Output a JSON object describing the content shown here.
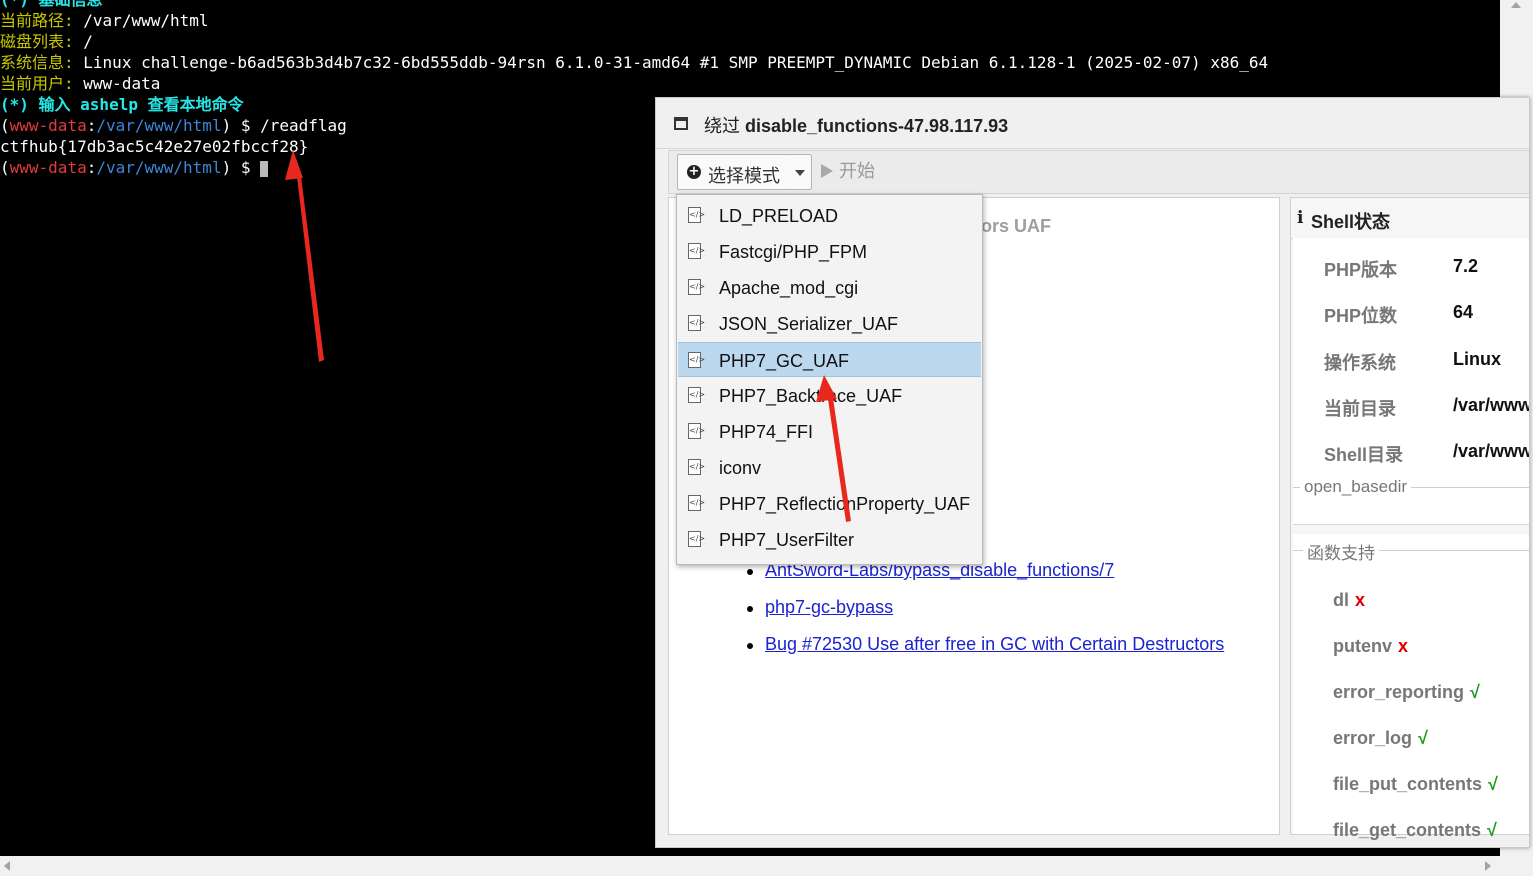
{
  "terminal": {
    "line0": "(*) 基础信息",
    "line1_label": "当前路径: ",
    "line1_value": "/var/www/html",
    "line2_label": "磁盘列表: ",
    "line2_value": "/",
    "line3_label": "系统信息: ",
    "line3_value": "Linux challenge-b6ad563b3d4b7c32-6bd555ddb-94rsn 6.1.0-31-amd64 #1 SMP PREEMPT_DYNAMIC Debian 6.1.128-1 (2025-02-07) x86_64",
    "line4_label": "当前用户: ",
    "line4_value": "www-data",
    "line5": "(*) 输入 ashelp 查看本地命令",
    "prompt_open": "(",
    "prompt_user": "www-data",
    "prompt_colon": ":",
    "prompt_path": "/var/www/html",
    "prompt_close": ") $ ",
    "command": "/readflag",
    "output": "ctfhub{17db3ac5c42e27e02fbccf28}"
  },
  "dialog": {
    "title_prefix": "绕过 ",
    "title_bold": "disable_functions-47.98.117.93",
    "mode_button": "选择模式",
    "start_button": "开始",
    "heading_partial": "ors UAF",
    "links": [
      "AntSword-Labs/bypass_disable_functions/7",
      "php7-gc-bypass",
      "Bug #72530 Use after free in GC with Certain Destructors"
    ]
  },
  "modes": [
    "LD_PRELOAD",
    "Fastcgi/PHP_FPM",
    "Apache_mod_cgi",
    "JSON_Serializer_UAF",
    "PHP7_GC_UAF",
    "PHP7_Backtrace_UAF",
    "PHP74_FFI",
    "iconv",
    "PHP7_ReflectionProperty_UAF",
    "PHP7_UserFilter"
  ],
  "shell_status": {
    "title": "Shell状态",
    "rows": [
      {
        "label": "PHP版本",
        "value": "7.2"
      },
      {
        "label": "PHP位数",
        "value": "64"
      },
      {
        "label": "操作系统",
        "value": "Linux"
      },
      {
        "label": "当前目录",
        "value": "/var/www/html"
      },
      {
        "label": "Shell目录",
        "value": "/var/www/html"
      }
    ],
    "open_basedir_legend": "open_basedir",
    "functions_legend": "函数支持",
    "functions": [
      {
        "name": "dl",
        "mark": "x"
      },
      {
        "name": "putenv",
        "mark": "x"
      },
      {
        "name": "error_reporting",
        "mark": "√"
      },
      {
        "name": "error_log",
        "mark": "√"
      },
      {
        "name": "file_put_contents",
        "mark": "√"
      },
      {
        "name": "file_get_contents",
        "mark": "√"
      }
    ]
  },
  "colors": {
    "terminal_bg": "#000000",
    "cyan": "#27e6e6",
    "yellow": "#c8c800",
    "red": "#e23b3b",
    "blue": "#3a86d8",
    "selected_bg": "#bcd8ee",
    "link": "#1a23cf",
    "arrow": "#e8281e"
  }
}
